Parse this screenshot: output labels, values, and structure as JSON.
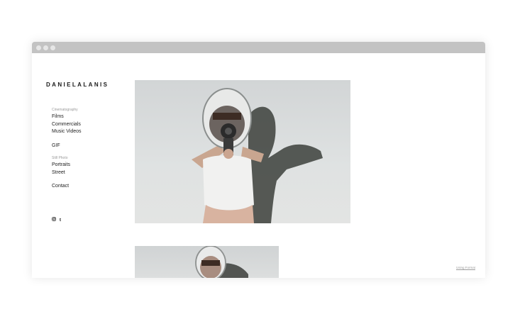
{
  "site": {
    "title": "DANIELALANIS"
  },
  "nav": {
    "cinematography_heading": "Cinematography",
    "films": "Films",
    "commercials": "Commercials",
    "music_videos": "Music Videos",
    "gif": "GIF",
    "still_photo_heading": "Still Photo",
    "portraits": "Portraits",
    "street": "Street",
    "contact": "Contact"
  },
  "social": {
    "instagram_icon": "instagram-icon",
    "tumblr_glyph": "t"
  },
  "gallery": {
    "images": [
      {
        "name": "astronaut-helmet-camera-photo"
      },
      {
        "name": "astronaut-helmet-portrait-photo"
      }
    ]
  },
  "footer": {
    "credit": "Using Format"
  },
  "colors": {
    "titlebar": "#c3c3c3",
    "text": "#222222",
    "muted": "#9a9a9a"
  }
}
